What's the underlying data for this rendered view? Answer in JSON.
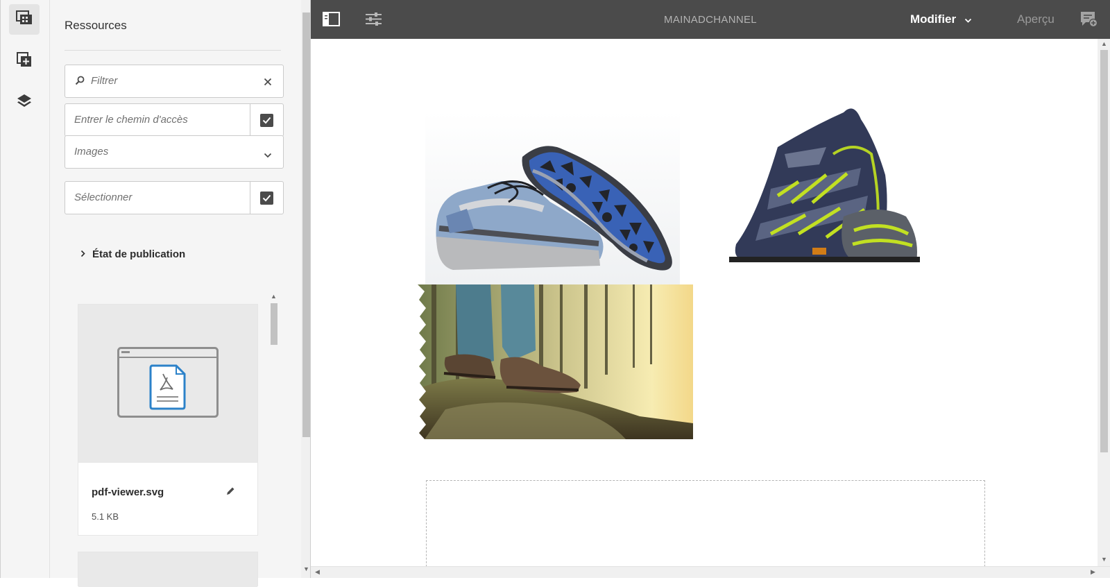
{
  "rail": {
    "items": [
      {
        "name": "assets-icon",
        "active": true
      },
      {
        "name": "components-icon",
        "active": false
      },
      {
        "name": "layers-icon",
        "active": false
      }
    ]
  },
  "panel": {
    "title": "Ressources",
    "filter_placeholder": "Filtrer",
    "path_placeholder": "Entrer le chemin d'accès",
    "type_select_value": "Images",
    "select_placeholder": "Sélectionner",
    "publish_state_label": "État de publication",
    "cards": [
      {
        "name": "pdf-viewer.svg",
        "size": "5.1 KB"
      }
    ]
  },
  "topbar": {
    "document_title": "MAINADCHANNEL",
    "mode_label": "Modifier",
    "preview_label": "Aperçu"
  },
  "colors": {
    "topbar": "#4b4b4b",
    "panel": "#f5f5f5",
    "accent_blue": "#2c82c9"
  }
}
